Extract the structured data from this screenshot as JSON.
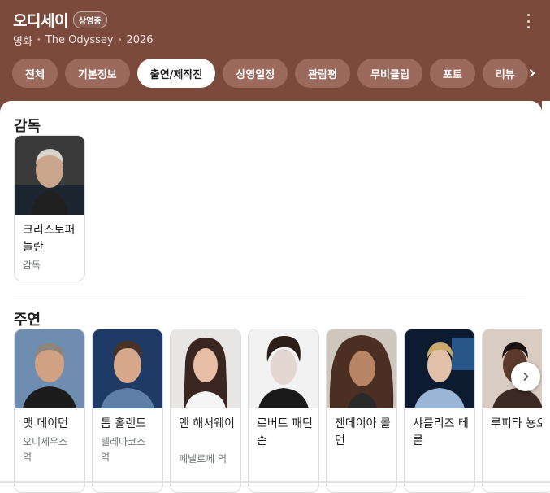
{
  "header": {
    "title": "오디세이",
    "badge": "상영중",
    "genre": "영화",
    "original_title": "The Odyssey",
    "year": "2026"
  },
  "tabs": [
    {
      "label": "전체"
    },
    {
      "label": "기본정보"
    },
    {
      "label": "출연/제작진",
      "active": true
    },
    {
      "label": "상영일정"
    },
    {
      "label": "관람평"
    },
    {
      "label": "무비클립"
    },
    {
      "label": "포토"
    },
    {
      "label": "리뷰"
    }
  ],
  "directors": {
    "title": "감독",
    "people": [
      {
        "name": "크리스토퍼 놀란",
        "role": "감독"
      }
    ]
  },
  "cast": {
    "title": "주연",
    "people": [
      {
        "name": "맷 데이먼",
        "role": "오디세우스 역"
      },
      {
        "name": "톰 홀랜드",
        "role": "텔레마코스 역"
      },
      {
        "name": "앤 해서웨이",
        "role": "페넬로페 역"
      },
      {
        "name": "로버트 패틴슨",
        "role": ""
      },
      {
        "name": "젠데이아 콜먼",
        "role": ""
      },
      {
        "name": "샤를리즈 테론",
        "role": ""
      },
      {
        "name": "루피타 뇽오",
        "role": ""
      }
    ]
  },
  "colors": {
    "header_bg": "#7c4a3c",
    "tab_bg": "#9b6a5d",
    "active_tab_bg": "#ffffff"
  },
  "icons": {
    "more": "more-vert-icon",
    "tabs_next": "chevron-right-icon",
    "row_next": "chevron-right-icon"
  }
}
